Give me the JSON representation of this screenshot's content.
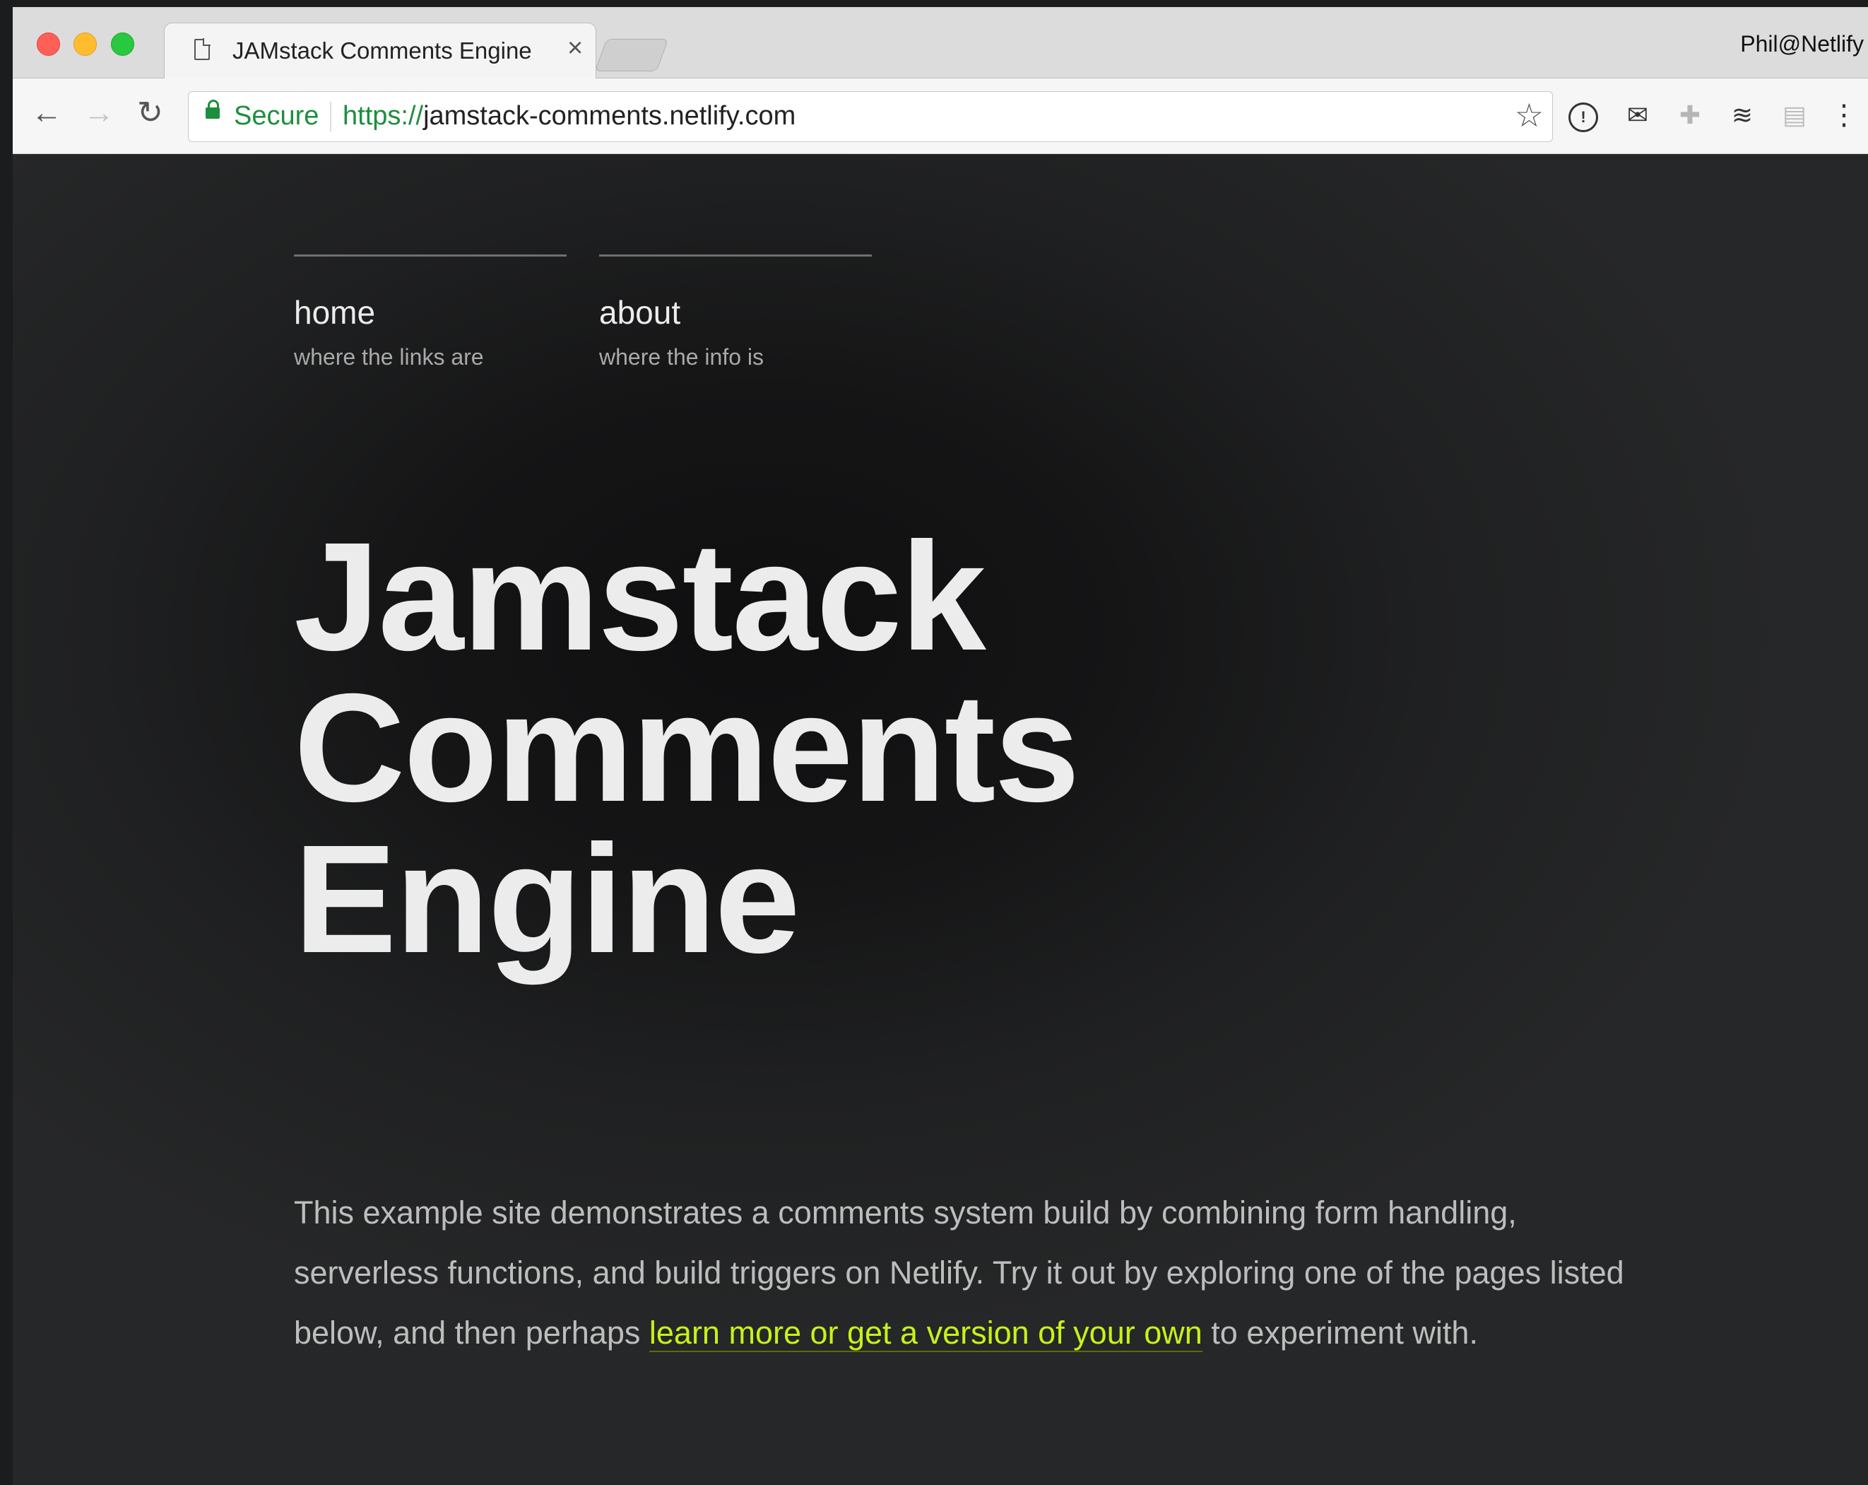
{
  "tab": {
    "title": "JAMstack Comments Engine",
    "close": "×"
  },
  "profile": "Phil@Netlify",
  "toolbar": {
    "secure_label": "Secure",
    "url_scheme": "https://",
    "url_host": "jamstack-comments.netlify.com"
  },
  "icons": {
    "back": "←",
    "forward": "→",
    "reload": "↻",
    "bookmark": "☆",
    "ext1": "!",
    "ext2": "✉",
    "ext3": "✚",
    "ext4": "≋",
    "ext5": "▤",
    "menu": "⋮"
  },
  "nav": [
    {
      "label": "home",
      "sub": "where the links are"
    },
    {
      "label": "about",
      "sub": "where the info is"
    }
  ],
  "hero": {
    "lines": [
      "Jamstack",
      "Comments",
      "Engine"
    ]
  },
  "intro": {
    "before": "This example site demonstrates a comments system build by combining form handling, serverless functions, and build triggers on Netlify. Try it out by exploring one of the pages listed below, and then perhaps ",
    "link": "learn more or get a version of your own",
    "after": " to experiment with."
  },
  "colors": {
    "link": "#c6f21a",
    "secure": "#1e8e3e",
    "background": "#1b1c1e"
  }
}
